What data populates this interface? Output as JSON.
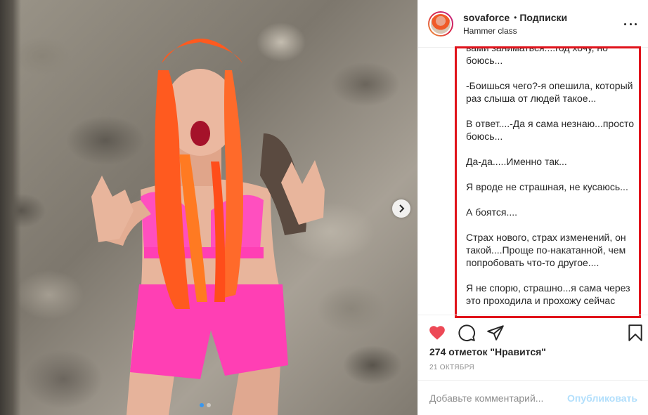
{
  "post": {
    "username": "sovaforce",
    "separator": "•",
    "follow_label": "Подписки",
    "location": "Hammer class",
    "caption_paragraphs": [
      "вами заниматься....год хочу, но боюсь...",
      "-Боишься чего?-я опешила, который раз слыша от людей такое...",
      "В ответ....-Да я сама незнаю...просто боюсь...",
      "Да-да.....Именно так...",
      "Я вроде не страшная, не кусаюсь...",
      "А боятся....",
      "Страх нового, страх изменений, он такой....Проще по-накатанной, чем попробовать что-то другое....",
      "Я не спорю, страшно...я сама через это проходила и прохожу сейчас"
    ],
    "likes": "274 отметок \"Нравится\"",
    "date": "21 ОКТЯБРЯ",
    "comment_placeholder": "Добавьте комментарий...",
    "publish_label": "Опубликовать"
  },
  "carousel": {
    "current_slide": 1,
    "total_slides": 2
  },
  "colors": {
    "like_red": "#ed4956",
    "highlight_border": "#e0131b",
    "publish_disabled": "#b2dffc",
    "shorts_pink": "#ff3fb4",
    "braids_orange": "#ff5a1f"
  },
  "icons": [
    "heart-icon",
    "comment-icon",
    "share-icon",
    "bookmark-icon",
    "more-options-icon",
    "chevron-right-icon"
  ]
}
